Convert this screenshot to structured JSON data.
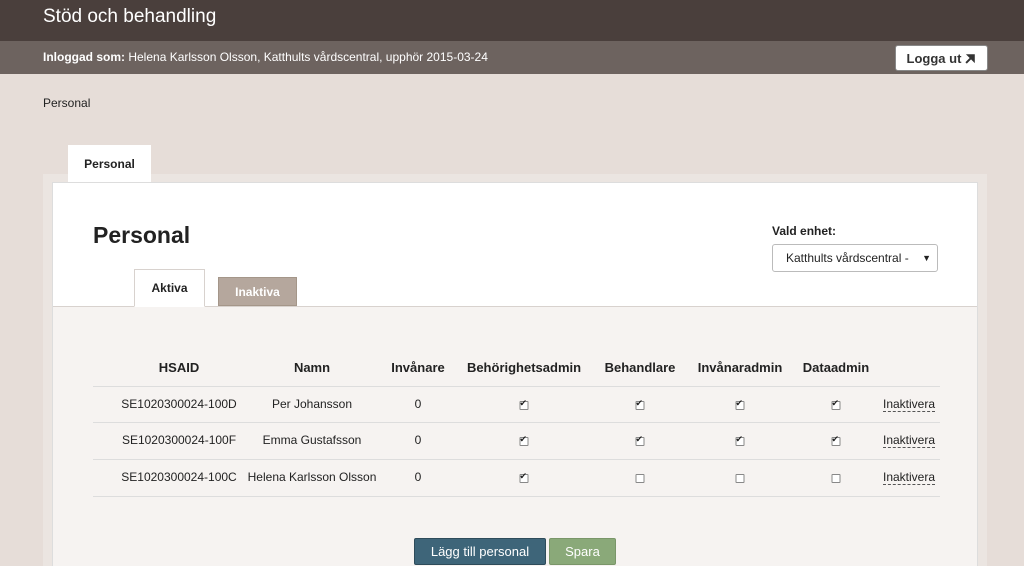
{
  "app": {
    "title": "Stöd och behandling"
  },
  "user": {
    "label": "Inloggad som:",
    "value": "Helena Karlsson Olsson, Katthults vårdscentral, upphör 2015-03-24",
    "logout_label": "Logga ut"
  },
  "breadcrumb": "Personal",
  "outer_tab": "Personal",
  "page": {
    "title": "Personal"
  },
  "unit": {
    "label": "Vald enhet:",
    "selected": "Katthults vårdscentral -"
  },
  "tabs": {
    "active": "Aktiva",
    "inactive": "Inaktiva"
  },
  "table": {
    "headers": [
      "HSAID",
      "Namn",
      "Invånare",
      "Behörighetsadmin",
      "Behandlare",
      "Invånaradmin",
      "Dataadmin"
    ],
    "rows": [
      {
        "hsaid": "SE1020300024-100D",
        "name": "Per Johansson",
        "invanare": "0",
        "behorighetsadmin": true,
        "behandlare": true,
        "invanaradmin": true,
        "dataadmin": true,
        "action": "Inaktivera"
      },
      {
        "hsaid": "SE1020300024-100F",
        "name": "Emma Gustafsson",
        "invanare": "0",
        "behorighetsadmin": true,
        "behandlare": true,
        "invanaradmin": true,
        "dataadmin": true,
        "action": "Inaktivera"
      },
      {
        "hsaid": "SE1020300024-100C",
        "name": "Helena Karlsson Olsson",
        "invanare": "0",
        "behorighetsadmin": true,
        "behandlare": false,
        "invanaradmin": false,
        "dataadmin": false,
        "action": "Inaktivera"
      }
    ]
  },
  "buttons": {
    "add": "Lägg till personal",
    "save": "Spara"
  }
}
